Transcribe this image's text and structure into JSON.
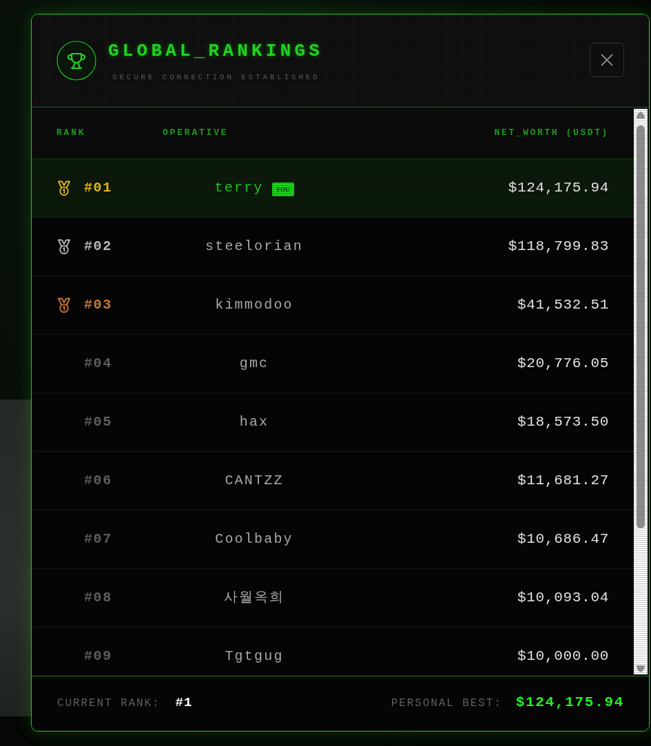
{
  "header": {
    "title": "GLOBAL_RANKINGS",
    "subtitle": "SECURE CONNECTION ESTABLISHED"
  },
  "table": {
    "columns": [
      "RANK",
      "OPERATIVE",
      "NET_WORTH (USDT)"
    ],
    "rows": [
      {
        "rank": "#01",
        "medal": true,
        "color": "#e6b414",
        "name": "terry",
        "you": true,
        "badge": "YOU",
        "net_worth": "$124,175.94"
      },
      {
        "rank": "#02",
        "medal": true,
        "color": "#b9b9b9",
        "name": "steelorian",
        "you": false,
        "net_worth": "$118,799.83"
      },
      {
        "rank": "#03",
        "medal": true,
        "color": "#c97a34",
        "name": "kimmodoo",
        "you": false,
        "net_worth": "$41,532.51"
      },
      {
        "rank": "#04",
        "medal": false,
        "name": "gmc",
        "you": false,
        "net_worth": "$20,776.05"
      },
      {
        "rank": "#05",
        "medal": false,
        "name": "hax",
        "you": false,
        "net_worth": "$18,573.50"
      },
      {
        "rank": "#06",
        "medal": false,
        "name": "CANTZZ",
        "you": false,
        "net_worth": "$11,681.27"
      },
      {
        "rank": "#07",
        "medal": false,
        "name": "Coolbaby",
        "you": false,
        "net_worth": "$10,686.47"
      },
      {
        "rank": "#08",
        "medal": false,
        "name": "사월옥희",
        "you": false,
        "net_worth": "$10,093.04"
      },
      {
        "rank": "#09",
        "medal": false,
        "name": "Tgtgug",
        "you": false,
        "net_worth": "$10,000.00"
      }
    ]
  },
  "footer": {
    "current_rank_label": "CURRENT RANK:",
    "current_rank": "#1",
    "personal_best_label": "PERSONAL BEST:",
    "personal_best": "$124,175.94"
  }
}
